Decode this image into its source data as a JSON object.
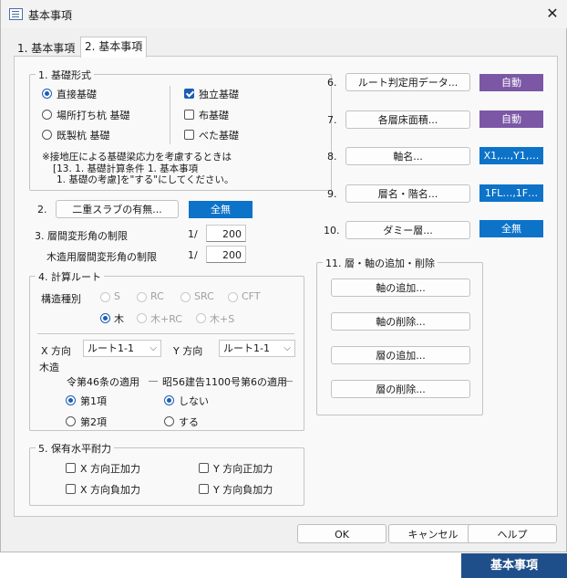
{
  "window": {
    "title": "基本事項"
  },
  "tabs": [
    {
      "label": "1. 基本事項"
    },
    {
      "label": "2. 基本事項"
    }
  ],
  "foundation": {
    "legend": "1. 基礎形式",
    "radios": [
      "直接基礎",
      "場所打ち杭 基礎",
      "既製杭 基礎"
    ],
    "checks": [
      "独立基礎",
      "布基礎",
      "べた基礎"
    ],
    "note1": "※接地圧による基礎梁応力を考慮するときは",
    "note2": "[13. 1. 基礎計算条件 1. 基本事項",
    "note3": "1. 基礎の考慮]を\"する\"にしてください。"
  },
  "double_slab": {
    "num": "2.",
    "button": "二重スラブの有無...",
    "badge": "全無"
  },
  "story_drift": {
    "label": "3. 層間変形角の制限",
    "prefix": "1/",
    "value": "200",
    "wood_label": "木造用層間変形角の制限",
    "wood_prefix": "1/",
    "wood_value": "200"
  },
  "calc_route": {
    "legend": "4. 計算ルート",
    "struct_label": "構造種別",
    "struct_opts": [
      "S",
      "RC",
      "SRC",
      "CFT",
      "木",
      "木+RC",
      "木+S"
    ],
    "x_label": "X 方向",
    "x_value": "ルート1-1",
    "y_label": "Y 方向",
    "y_value": "ルート1-1",
    "wood_title": "木造",
    "art46": "令第46条の適用",
    "s56": "昭56建告1100号第6の適用",
    "art46_opts": [
      "第1項",
      "第2項"
    ],
    "s56_opts": [
      "しない",
      "する"
    ]
  },
  "retained_strength": {
    "legend": "5. 保有水平耐力",
    "opts": [
      "X 方向正加力",
      "Y 方向正加力",
      "X 方向負加力",
      "Y 方向負加力"
    ]
  },
  "right_items": [
    {
      "num": "6.",
      "button": "ルート判定用データ...",
      "badge": "自動"
    },
    {
      "num": "7.",
      "button": "各層床面積...",
      "badge": "自動"
    },
    {
      "num": "8.",
      "button": "軸名...",
      "badge": "X1,…,Y1,…"
    },
    {
      "num": "9.",
      "button": "層名・階名...",
      "badge": "1FL…,1F…"
    },
    {
      "num": "10.",
      "button": "ダミー層...",
      "badge": "全無"
    }
  ],
  "axis_edit": {
    "legend": "11. 層・軸の追加・削除",
    "buttons": [
      "軸の追加...",
      "軸の削除...",
      "層の追加...",
      "層の削除..."
    ]
  },
  "footer": {
    "ok": "OK",
    "cancel": "キャンセル",
    "help": "ヘルプ"
  },
  "brand": {
    "text": "基本事項"
  },
  "colors": {
    "purple": "#7b57a6",
    "blue": "#0d73c9",
    "brand": "#1f4f8b"
  }
}
